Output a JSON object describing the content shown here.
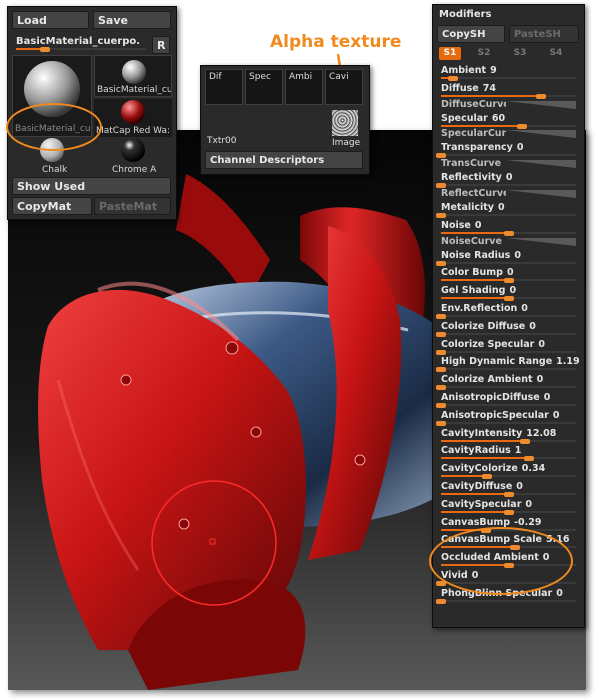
{
  "annotation": {
    "alpha_texture": "Alpha texture"
  },
  "material_panel": {
    "load": "Load",
    "save": "Save",
    "current_material": "BasicMaterial_cuerpo.",
    "r_button": "R",
    "slots": [
      {
        "label": "BasicMaterial_cu"
      },
      {
        "label": "BasicMaterial_cu"
      },
      {
        "label": "MatCap Red Wa:"
      },
      {
        "label": "Chalk"
      },
      {
        "label": "Chrome A"
      }
    ],
    "show_used": "Show Used",
    "copy_mat": "CopyMat",
    "paste_mat": "PasteMat",
    "colors": {
      "accent": "#e86a0e",
      "panel": "#2a2a2a"
    }
  },
  "channels_panel": {
    "channels": [
      "Dif",
      "Spec",
      "Ambi",
      "Cavi"
    ],
    "texture_label": "Txtr00",
    "image_label": "Image",
    "descriptors_button": "Channel Descriptors"
  },
  "modifiers": {
    "title": "Modifiers",
    "copy_sh": "CopySH",
    "paste_sh": "PasteSH",
    "shader_tabs": [
      "S1",
      "S2",
      "S3",
      "S4"
    ],
    "rows": [
      {
        "label": "Ambient",
        "value": "9",
        "fraction": 0.09
      },
      {
        "label": "Diffuse",
        "value": "74",
        "fraction": 0.74
      },
      {
        "label": "DiffuseCurve",
        "curve": true
      },
      {
        "label": "Specular",
        "value": "60",
        "fraction": 0.6
      },
      {
        "label": "SpecularCurve",
        "curve": true
      },
      {
        "label": "Transparency",
        "value": "0",
        "fraction": 0.0
      },
      {
        "label": "TransCurve",
        "curve": true
      },
      {
        "label": "Reflectivity",
        "value": "0",
        "fraction": 0.0
      },
      {
        "label": "ReflectCurve",
        "curve": true
      },
      {
        "label": "Metalicity",
        "value": "0",
        "fraction": 0.0
      },
      {
        "label": "Noise",
        "value": "0",
        "fraction": 0.5
      },
      {
        "label": "NoiseCurve",
        "curve": true
      },
      {
        "label": "Noise Radius",
        "value": "0",
        "fraction": 0.0
      },
      {
        "label": "Color Bump",
        "value": "0",
        "fraction": 0.5
      },
      {
        "label": "Gel Shading",
        "value": "0",
        "fraction": 0.5
      },
      {
        "label": "Env.Reflection",
        "value": "0",
        "fraction": 0.0
      },
      {
        "label": "Colorize Diffuse",
        "value": "0",
        "fraction": 0.0
      },
      {
        "label": "Colorize Specular",
        "value": "0",
        "fraction": 0.0
      },
      {
        "label": "High Dynamic Range",
        "value": "1.19",
        "fraction": 0.0
      },
      {
        "label": "Colorize Ambient",
        "value": "0",
        "fraction": 0.0
      },
      {
        "label": "AnisotropicDiffuse",
        "value": "0",
        "fraction": 0.0
      },
      {
        "label": "AnisotropicSpecular",
        "value": "0",
        "fraction": 0.0
      },
      {
        "label": "CavityIntensity",
        "value": "12.08",
        "fraction": 0.62
      },
      {
        "label": "CavityRadius",
        "value": "1",
        "fraction": 0.65
      },
      {
        "label": "CavityColorize",
        "value": "0.34",
        "fraction": 0.34
      },
      {
        "label": "CavityDiffuse",
        "value": "0",
        "fraction": 0.5
      },
      {
        "label": "CavitySpecular",
        "value": "0",
        "fraction": 0.5
      },
      {
        "label": "CanvasBump",
        "value": "-0.29",
        "fraction": 0.33
      },
      {
        "label": "CanvasBump Scale",
        "value": "5.16",
        "fraction": 0.55
      },
      {
        "label": "Occluded Ambient",
        "value": "0",
        "fraction": 0.5
      },
      {
        "label": "Vivid",
        "value": "0",
        "fraction": 0.0
      },
      {
        "label": "PhongBlinn Specular",
        "value": "0",
        "fraction": 0.0
      }
    ]
  }
}
